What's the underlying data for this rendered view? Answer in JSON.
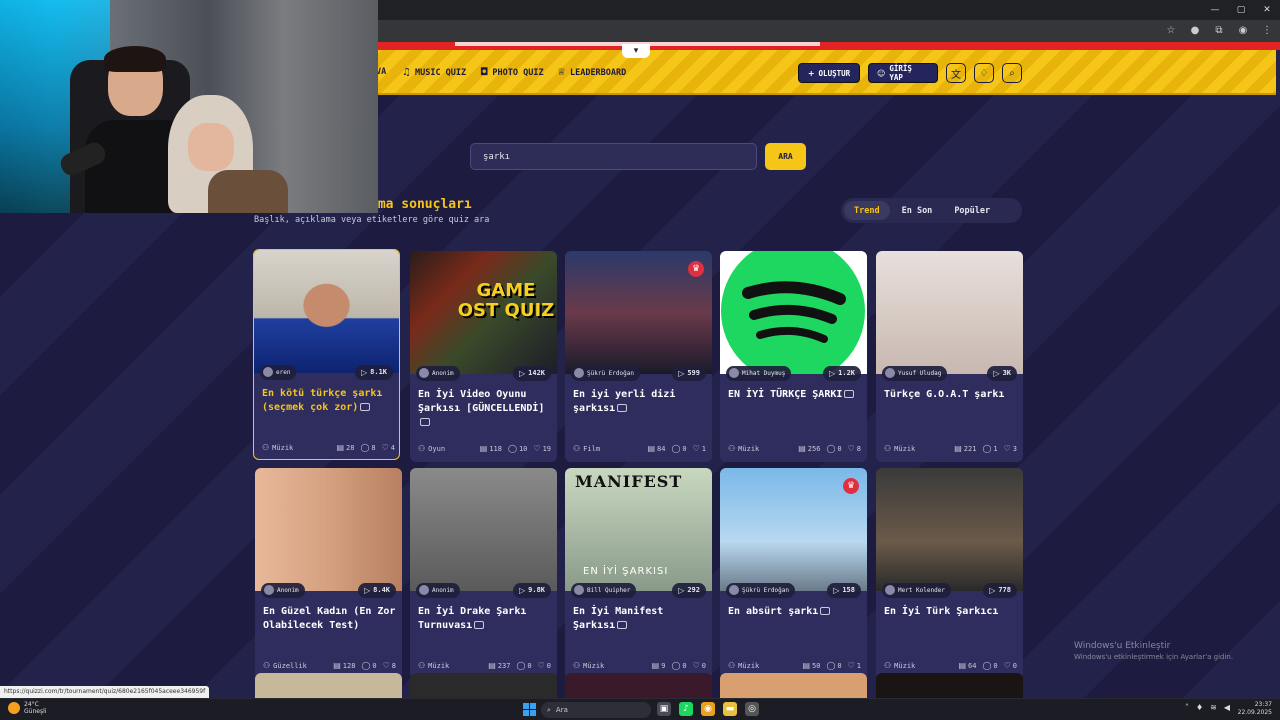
{
  "nav": {
    "items": [
      {
        "label": "VA",
        "icon": "trivia-icon"
      },
      {
        "label": "MUSIC QUIZ",
        "icon": "music-note-icon"
      },
      {
        "label": "PHOTO QUIZ",
        "icon": "camera-icon"
      },
      {
        "label": "LEADERBOARD",
        "icon": "trophy-icon"
      }
    ],
    "create_label": "OLUŞTUR",
    "login_label": "GİRİŞ YAP"
  },
  "search": {
    "value": "şarkı",
    "button_label": "ARA"
  },
  "results": {
    "title": "ama sonuçları",
    "subtitle": "Başlık, açıklama veya etiketlere göre quiz ara"
  },
  "sort_tabs": [
    {
      "label": "Trend",
      "active": true
    },
    {
      "label": "En Son",
      "active": false
    },
    {
      "label": "Popüler",
      "active": false
    }
  ],
  "cards": [
    {
      "author": "eren",
      "plays": "8.1K",
      "title": "En kötü türkçe şarkı (seçmek çok zor)",
      "category": "Müzik",
      "questions": "28",
      "comments": "8",
      "likes": "4"
    },
    {
      "author": "Anonim",
      "plays": "142K",
      "title": "En İyi Video Oyunu Şarkısı [GÜNCELLENDİ]",
      "category": "Oyun",
      "questions": "118",
      "comments": "10",
      "likes": "19",
      "thumb_text": "GAME OST QUIZ"
    },
    {
      "author": "Şükrü Erdoğan",
      "plays": "599",
      "title": "En iyi yerli dizi şarkısı",
      "category": "Film",
      "questions": "84",
      "comments": "0",
      "likes": "1"
    },
    {
      "author": "Mihat Duymuş",
      "plays": "1.2K",
      "title": "EN İYİ TÜRKÇE ŞARKI",
      "category": "Müzik",
      "questions": "256",
      "comments": "0",
      "likes": "8"
    },
    {
      "author": "Yusuf Uludag",
      "plays": "3K",
      "title": "Türkçe G.O.A.T şarkı",
      "category": "Müzik",
      "questions": "221",
      "comments": "1",
      "likes": "3"
    },
    {
      "author": "Anonim",
      "plays": "8.4K",
      "title": "En Güzel Kadın (En Zor Olabilecek Test)",
      "category": "Güzellik",
      "questions": "128",
      "comments": "0",
      "likes": "8"
    },
    {
      "author": "Anonim",
      "plays": "9.8K",
      "title": "En İyi Drake Şarkı Turnuvası",
      "category": "Müzik",
      "questions": "237",
      "comments": "0",
      "likes": "0"
    },
    {
      "author": "Bill Quipher",
      "plays": "292",
      "title": "En İyi Manifest Şarkısı",
      "category": "Müzik",
      "questions": "9",
      "comments": "0",
      "likes": "0",
      "thumb_text": "MANIFEST",
      "thumb_sub": "EN İYİ ŞARKISI"
    },
    {
      "author": "Şükrü Erdoğan",
      "plays": "158",
      "title": "En absürt şarkı",
      "category": "Müzik",
      "questions": "50",
      "comments": "0",
      "likes": "1"
    },
    {
      "author": "Mert Kolender",
      "plays": "778",
      "title": "En İyi Türk Şarkıcı",
      "category": "Müzik",
      "questions": "64",
      "comments": "0",
      "likes": "0"
    }
  ],
  "windows_activation": {
    "title": "Windows'u Etkinleştir",
    "subtitle": "Windows'u etkinleştirmek için Ayarlar'a gidin."
  },
  "status_url": "https://quizzi.com/tr/tournament/quiz/680e2165f045aceee346959f",
  "taskbar": {
    "weather_temp": "24°C",
    "weather_desc": "Güneşli",
    "search_placeholder": "Ara",
    "time": "23:37",
    "date": "22.09.2025"
  }
}
